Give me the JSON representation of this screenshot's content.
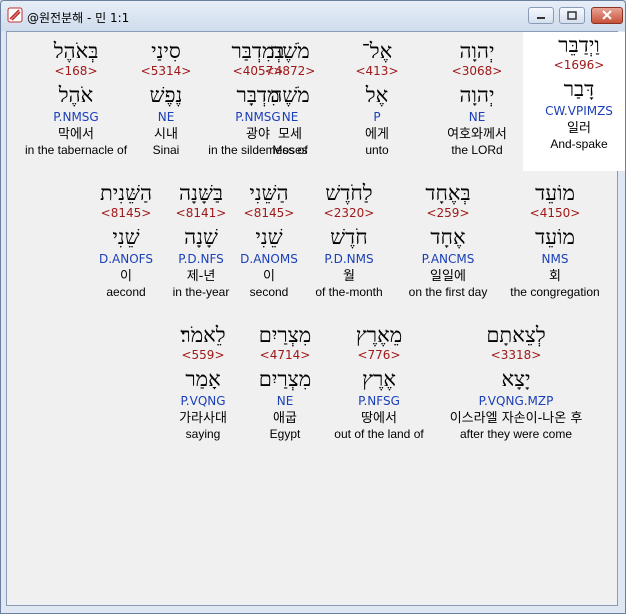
{
  "window": {
    "title": "@원전분해 - 민 1:1"
  },
  "verse": [
    {
      "hebrew": "וַיְדַבֵּר",
      "strong": "<1696>",
      "lemma": "דָּבַר",
      "parse": "CW.VPIMZS",
      "korean": "일러",
      "english": "And-spake"
    },
    {
      "hebrew": "יְהוָה",
      "strong": "<3068>",
      "lemma": "יְהוָה",
      "parse": "NE",
      "korean": "여호와께서",
      "english": "the LORd"
    },
    {
      "hebrew": "אֶל־",
      "strong": "<413>",
      "lemma": "אֶל",
      "parse": "P",
      "korean": "에게",
      "english": "unto"
    },
    {
      "hebrew": "מֹשֶׁה",
      "strong": "<4872>",
      "lemma": "מֹשֶׁה",
      "parse": "NE",
      "korean": "모세",
      "english": "Moses"
    },
    {
      "hebrew": "בְּמִדְבַּר",
      "strong": "<4057>",
      "lemma": "מִדְבָּר",
      "parse": "P.NMSG",
      "korean": "광야",
      "english": "in the sildemess of"
    },
    {
      "hebrew": "סִינַי",
      "strong": "<5314>",
      "lemma": "נֶפֶשׁ",
      "parse": "NE",
      "korean": "시내",
      "english": "Sinai"
    },
    {
      "hebrew": "בְּאֹהֶל",
      "strong": "<168>",
      "lemma": "אֹהֶל",
      "parse": "P.NMSG",
      "korean": "막에서",
      "english": "in the tabernacle of"
    },
    {
      "hebrew": "מוֹעֵד",
      "strong": "<4150>",
      "lemma": "מוֹעֵד",
      "parse": "NMS",
      "korean": "회",
      "english": "the congregation"
    },
    {
      "hebrew": "בְּאֶחָד",
      "strong": "<259>",
      "lemma": "אֶחָד",
      "parse": "P.ANCMS",
      "korean": "일일에",
      "english": "on the first day"
    },
    {
      "hebrew": "לַחֹדֶשׁ",
      "strong": "<2320>",
      "lemma": "חֹדֶשׁ",
      "parse": "P.D.NMS",
      "korean": "월",
      "english": "of the-month"
    },
    {
      "hebrew": "הַשֵּׁנִי",
      "strong": "<8145>",
      "lemma": "שֵׁנִי",
      "parse": "D.ANOMS",
      "korean": "이",
      "english": "second"
    },
    {
      "hebrew": "בַּשָּׁנָה",
      "strong": "<8141>",
      "lemma": "שָׁנָה",
      "parse": "P.D.NFS",
      "korean": "제-년",
      "english": "in the-year"
    },
    {
      "hebrew": "הַשֵּׁנִית",
      "strong": "<8145>",
      "lemma": "שֵׁנִי",
      "parse": "D.ANOFS",
      "korean": "이",
      "english": "aecond"
    },
    {
      "hebrew": "לְצֵאתָם",
      "strong": "<3318>",
      "lemma": "יָצָא",
      "parse": "P.VQNG.MZP",
      "korean": "이스라엘 자손이-나온 후",
      "english": "after they were come"
    },
    {
      "hebrew": "מֵאֶרֶץ",
      "strong": "<776>",
      "lemma": "אֶרֶץ",
      "parse": "P.NFSG",
      "korean": "땅에서",
      "english": "out of the land of"
    },
    {
      "hebrew": "מִצְרַיִם",
      "strong": "<4714>",
      "lemma": "מִצְרַיִם",
      "parse": "NE",
      "korean": "애굽",
      "english": "Egypt"
    },
    {
      "hebrew": "לֵאמֹר׃",
      "strong": "<559>",
      "lemma": "אָמַר",
      "parse": "P.VQNG",
      "korean": "가라사대",
      "english": "saying"
    }
  ]
}
